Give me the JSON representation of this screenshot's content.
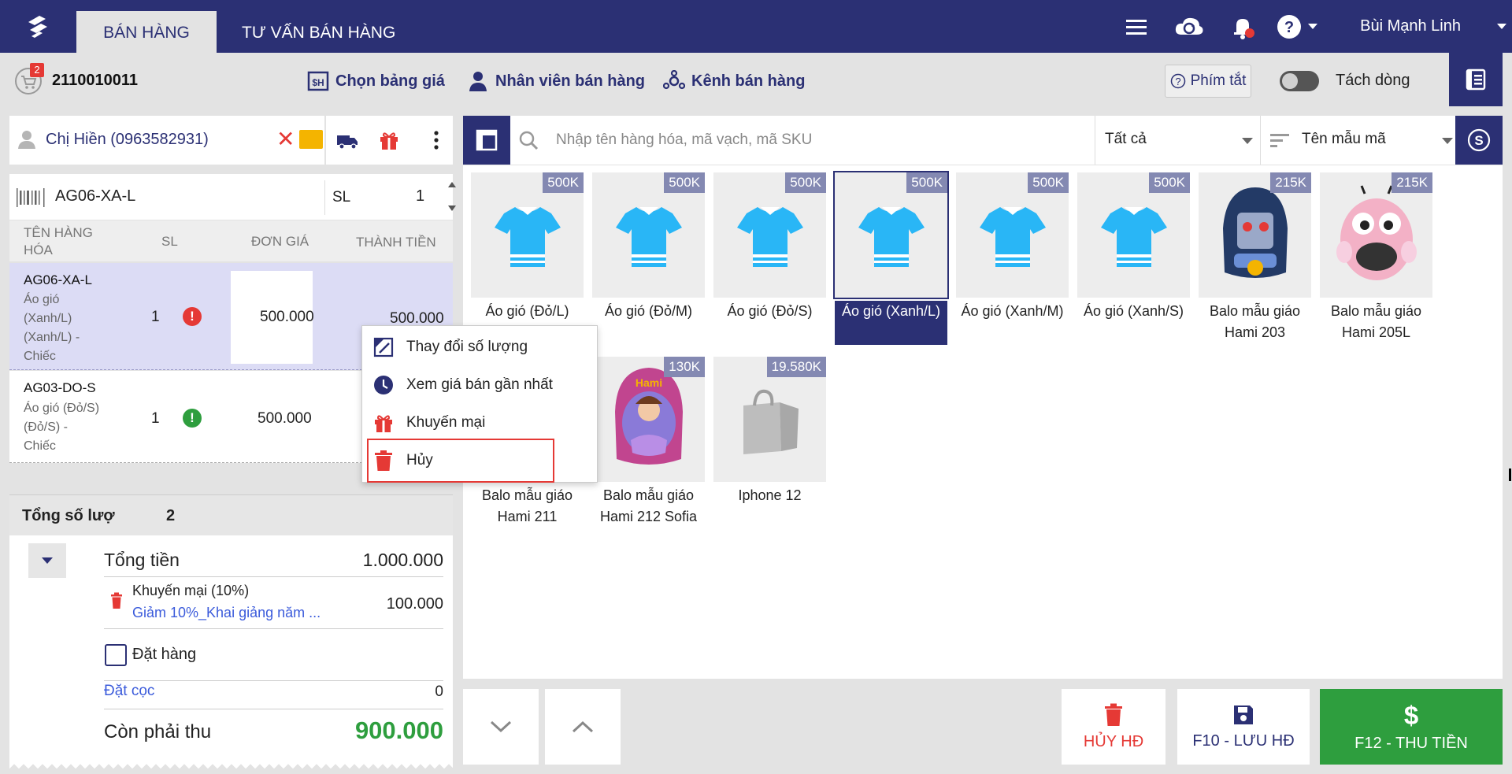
{
  "app": {
    "tabs": [
      {
        "label": "BÁN HÀNG",
        "active": true
      },
      {
        "label": "TƯ VẤN BÁN HÀNG",
        "active": false
      }
    ],
    "user_name": "Bùi Mạnh Linh",
    "icons": [
      "menu-icon",
      "cloud-sync-icon",
      "bell-icon",
      "help-icon"
    ]
  },
  "toolbar": {
    "cart_badge": "2",
    "invoice_number": "2110010011",
    "price_list_label": "Chọn bảng giá",
    "staff_label": "Nhân viên bán hàng",
    "channel_label": "Kênh bán hàng",
    "shortcut_label": "Phím tắt",
    "split_label": "Tách dòng",
    "split_enabled": false
  },
  "customer": {
    "name": "Chị Hiền (0963582931)"
  },
  "barcode": {
    "value": "AG06-XA-L",
    "qty_label": "SL",
    "qty_value": "1"
  },
  "cart": {
    "headers": {
      "name_line1": "TÊN HÀNG",
      "name_line2": "HÓA",
      "qty": "SL",
      "unit_price": "ĐƠN GIÁ",
      "total": "THÀNH TIỀN"
    },
    "items": [
      {
        "code": "AG06-XA-L",
        "desc_lines": [
          "Áo gió",
          "(Xanh/L)",
          "(Xanh/L) -",
          "Chiếc"
        ],
        "qty": "1",
        "status": "!",
        "status_color": "#e53935",
        "unit_price": "500.000",
        "total": "500.000"
      },
      {
        "code": "AG03-DO-S",
        "desc_lines": [
          "Áo gió (Đỏ/S)",
          "(Đỏ/S) -",
          "Chiếc"
        ],
        "qty": "1",
        "status": "!",
        "status_color": "#2e9e3e",
        "unit_price": "500.000",
        "total": ""
      }
    ]
  },
  "summary": {
    "count_label": "Tổng số lượ",
    "count_value": "2",
    "total_label": "Tổng tiền",
    "total_value": "1.000.000",
    "promo_label": "Khuyến mại (10%)",
    "promo_desc": "Giảm 10%_Khai giảng năm ...",
    "promo_value": "100.000",
    "order_label": "Đặt hàng",
    "order_checked": false,
    "deposit_label": "Đặt cọc",
    "deposit_value": "0",
    "due_label": "Còn phải thu",
    "due_value": "900.000"
  },
  "context_menu": {
    "items": [
      {
        "label": "Thay đổi số lượng",
        "icon": "edit-quantity-icon"
      },
      {
        "label": "Xem giá bán gần nhất",
        "icon": "clock-icon"
      },
      {
        "label": "Khuyến mại",
        "icon": "gift-icon"
      },
      {
        "label": "Hủy",
        "icon": "trash-icon"
      }
    ]
  },
  "search": {
    "placeholder": "Nhập tên hàng hóa, mã vạch, mã SKU",
    "filter_value": "Tất cả",
    "sort_value": "Tên mẫu mã"
  },
  "products": [
    {
      "name": "Áo gió (Đỏ/L)",
      "price": "500K",
      "kind": "shirt",
      "selected": false
    },
    {
      "name": "Áo gió (Đỏ/M)",
      "price": "500K",
      "kind": "shirt",
      "selected": false
    },
    {
      "name": "Áo gió (Đỏ/S)",
      "price": "500K",
      "kind": "shirt",
      "selected": false
    },
    {
      "name": "Áo gió (Xanh/L)",
      "price": "500K",
      "kind": "shirt",
      "selected": true
    },
    {
      "name": "Áo gió (Xanh/M)",
      "price": "500K",
      "kind": "shirt",
      "selected": false
    },
    {
      "name": "Áo gió (Xanh/S)",
      "price": "500K",
      "kind": "shirt",
      "selected": false
    },
    {
      "name": "Balo mẫu giáo Hami 203",
      "price": "215K",
      "kind": "backpack-blue",
      "selected": false
    },
    {
      "name": "Balo mẫu giáo Hami 205L",
      "price": "215K",
      "kind": "backpack-pink",
      "selected": false
    },
    {
      "name": "Balo mẫu giáo Hami 211",
      "price": "",
      "kind": "hidden",
      "selected": false
    },
    {
      "name": "Balo mẫu giáo Hami 212 Sofia",
      "price": "130K",
      "kind": "backpack-purple",
      "selected": false
    },
    {
      "name": "Iphone 12",
      "price": "19.580K",
      "kind": "bag",
      "selected": false
    }
  ],
  "actions": {
    "cancel_label": "HỦY HĐ",
    "save_label": "F10 - LƯU HĐ",
    "pay_label": "F12 - THU TIỀN"
  },
  "colors": {
    "brand": "#2b3074",
    "danger": "#e53935",
    "success": "#2e9e3e",
    "shirt": "#29b6f6",
    "price_tag": "#8489b2"
  }
}
